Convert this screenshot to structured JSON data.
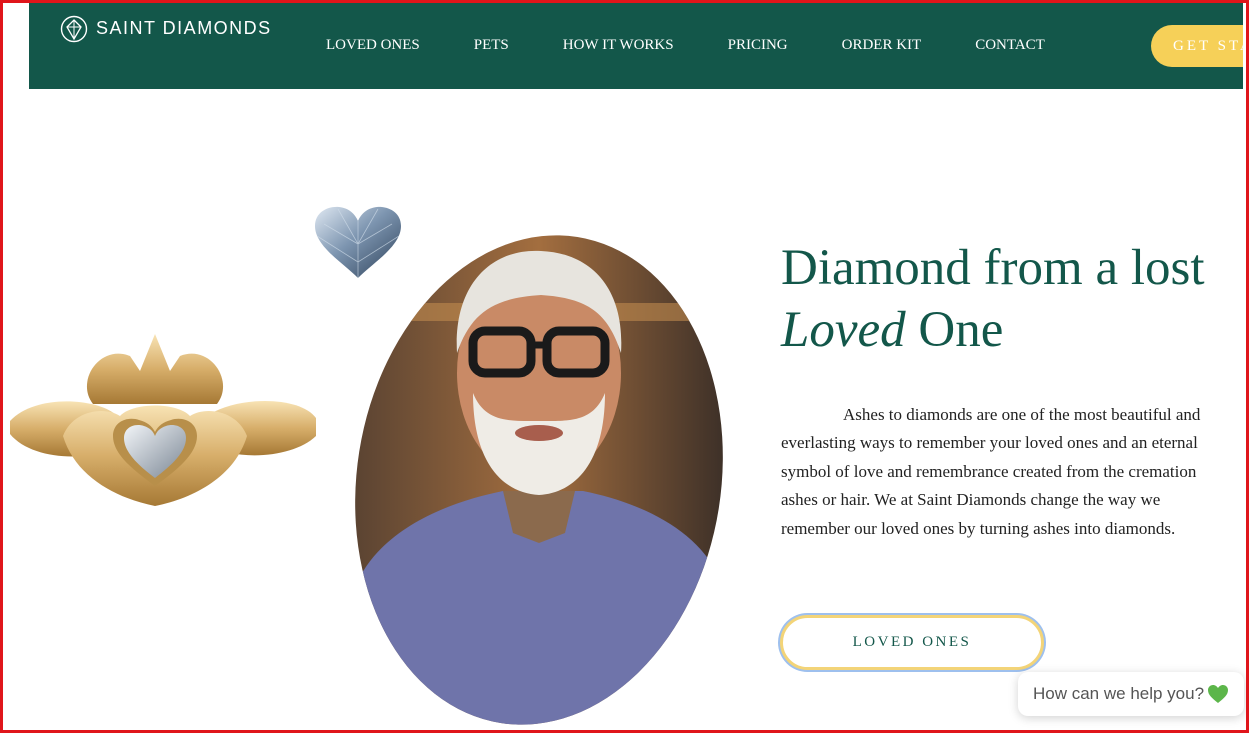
{
  "brand": {
    "name": "SAINT DIAMONDS",
    "logo_icon": "diamond-leaf-logo-icon"
  },
  "nav": {
    "items": [
      {
        "label": "LOVED ONES"
      },
      {
        "label": "PETS"
      },
      {
        "label": "HOW IT WORKS"
      },
      {
        "label": "PRICING"
      },
      {
        "label": "ORDER KIT"
      },
      {
        "label": "CONTACT"
      }
    ],
    "cta_label": "GET STARTED"
  },
  "hero": {
    "title_part1": "Diamond from a lost ",
    "title_emphasis": "Loved",
    "title_part2": " One",
    "body": "Ashes to diamonds are one of the most beautiful and everlasting ways to remember your loved ones and an eternal symbol of love and remembrance created from the cremation ashes or hair. We at Saint Diamonds change the way we remember our loved ones by turning ashes into diamonds.",
    "button_label": "LOVED ONES"
  },
  "chat_widget": {
    "text": "How can we help you?",
    "icon": "green-heart-icon"
  },
  "colors": {
    "primary": "#13574a",
    "accent": "#f6d058",
    "frame": "#e0151b",
    "button_outline": "#9ec0ee"
  }
}
